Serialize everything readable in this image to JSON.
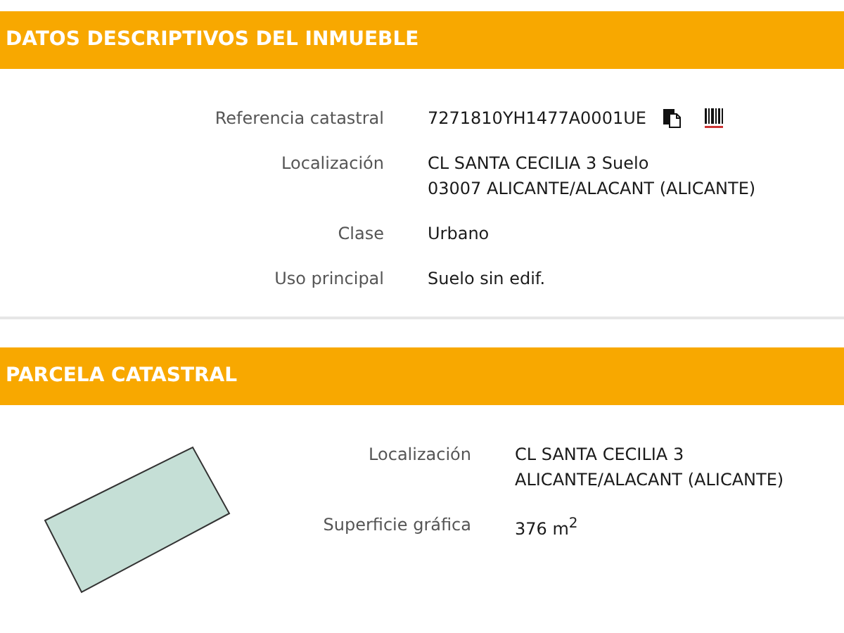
{
  "sections": [
    {
      "title": "DATOS DESCRIPTIVOS DEL INMUEBLE",
      "kind": "fields",
      "rows": [
        {
          "label": "Referencia catastral",
          "lines": [
            "7271810YH1477A0001UE"
          ],
          "kind": "reference"
        },
        {
          "label": "Localización",
          "lines": [
            "CL SANTA CECILIA 3 Suelo",
            "03007 ALICANTE/ALACANT (ALICANTE)"
          ],
          "kind": "text"
        },
        {
          "label": "Clase",
          "lines": [
            "Urbano"
          ],
          "kind": "text"
        },
        {
          "label": "Uso principal",
          "lines": [
            "Suelo sin edif."
          ],
          "kind": "text"
        }
      ]
    },
    {
      "title": "PARCELA CATASTRAL",
      "kind": "parcel",
      "rows": [
        {
          "label": "Localización",
          "lines": [
            "CL SANTA CECILIA 3",
            "ALICANTE/ALACANT (ALICANTE)"
          ]
        },
        {
          "label": "Superficie gráfica",
          "lines": [
            "376 m$^{2}$"
          ]
        }
      ]
    }
  ]
}
